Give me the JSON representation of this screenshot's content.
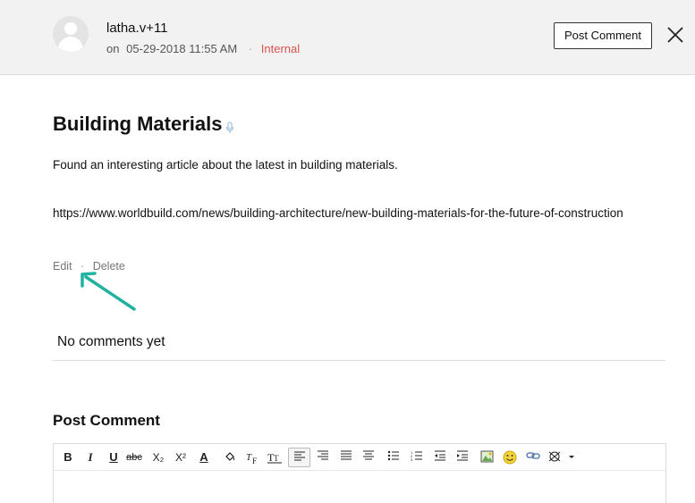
{
  "header": {
    "author": "latha.v+11",
    "on_label": "on",
    "date": "05-29-2018 11:55 AM",
    "separator": "·",
    "visibility": "Internal",
    "post_comment_button": "Post Comment",
    "visibility_color": "#d9534f"
  },
  "article": {
    "title": "Building Materials",
    "body": "Found an interesting article about the latest in building materials.",
    "link": "https://www.worldbuild.com/news/building-architecture/new-building-materials-for-the-future-of-construction",
    "edit_label": "Edit",
    "separator": "·",
    "delete_label": "Delete"
  },
  "comments": {
    "empty_text": "No comments yet"
  },
  "composer": {
    "heading": "Post Comment",
    "toolbar_items": [
      {
        "name": "bold",
        "label": "B"
      },
      {
        "name": "italic",
        "label": "I"
      },
      {
        "name": "underline",
        "label": "U"
      },
      {
        "name": "strikethrough",
        "label": "abc"
      },
      {
        "name": "subscript",
        "label": "X₂"
      },
      {
        "name": "superscript",
        "label": "X²"
      },
      {
        "name": "font-color",
        "label": "A"
      },
      {
        "name": "background-color",
        "label": ""
      },
      {
        "name": "font-family",
        "label": ""
      },
      {
        "name": "font-size",
        "label": ""
      },
      {
        "name": "align-left",
        "label": ""
      },
      {
        "name": "align-right",
        "label": ""
      },
      {
        "name": "justify",
        "label": ""
      },
      {
        "name": "align-center",
        "label": ""
      },
      {
        "name": "bullet-list",
        "label": ""
      },
      {
        "name": "numbered-list",
        "label": ""
      },
      {
        "name": "outdent",
        "label": ""
      },
      {
        "name": "indent",
        "label": ""
      },
      {
        "name": "insert-image",
        "label": ""
      },
      {
        "name": "emoji",
        "label": ""
      },
      {
        "name": "insert-link",
        "label": ""
      },
      {
        "name": "more",
        "label": ""
      }
    ],
    "accent_color": "#20b2a0"
  }
}
